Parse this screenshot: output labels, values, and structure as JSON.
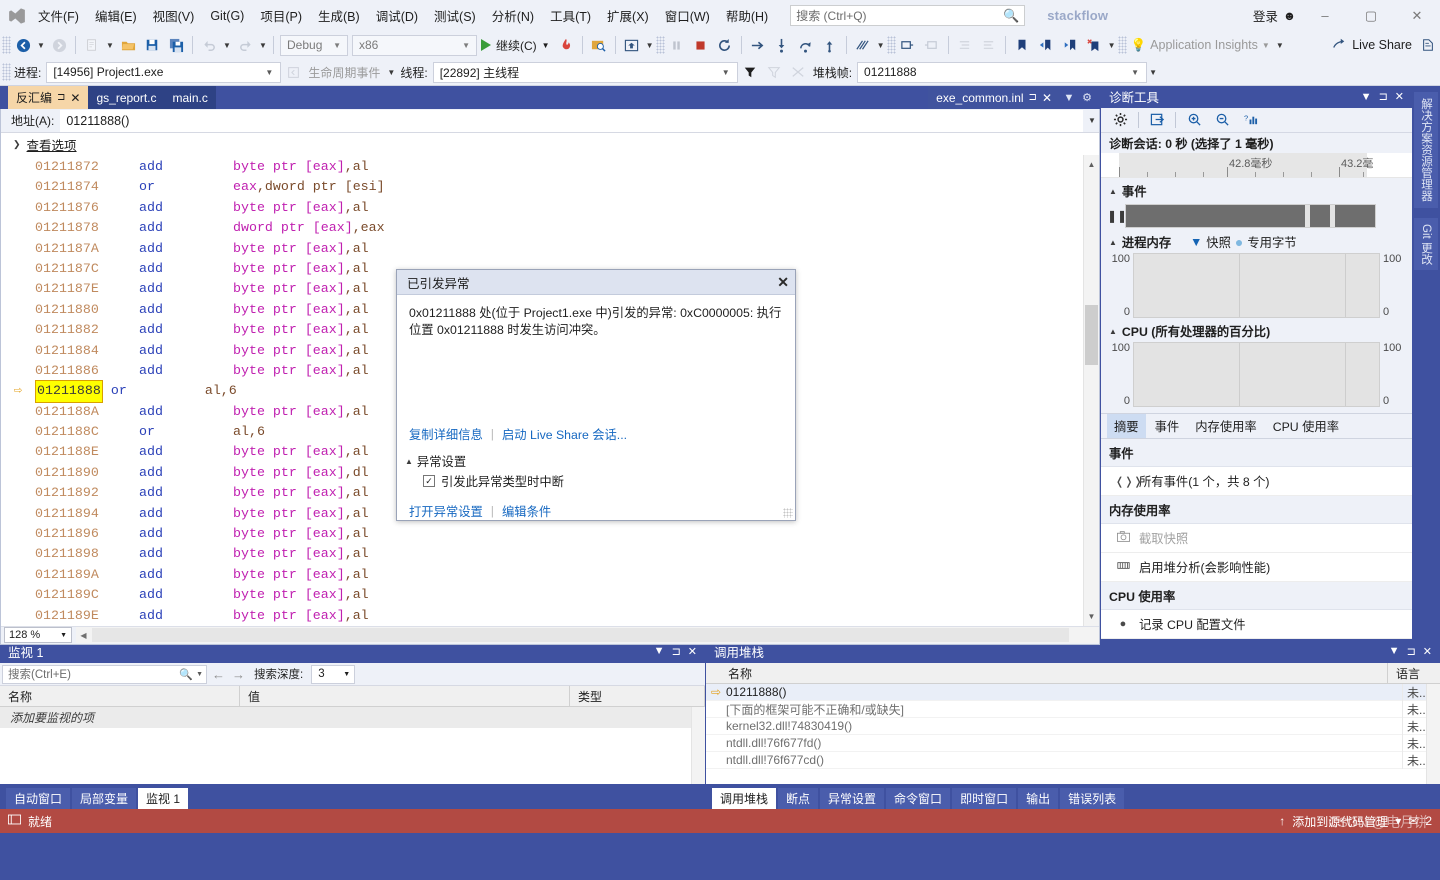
{
  "menu": {
    "logo_icon": "visual-studio-logo",
    "items": [
      "文件(F)",
      "编辑(E)",
      "视图(V)",
      "Git(G)",
      "项目(P)",
      "生成(B)",
      "调试(D)",
      "测试(S)",
      "分析(N)",
      "工具(T)",
      "扩展(X)",
      "窗口(W)",
      "帮助(H)"
    ],
    "search_placeholder": "搜索 (Ctrl+Q)",
    "search_icon": "search-icon",
    "brand": "stackflow",
    "login_label": "登录",
    "login_icon": "account-icon",
    "window_buttons": [
      "–",
      "▢",
      "✕"
    ]
  },
  "toolbar": {
    "nav_back_icon": "navigate-back-icon",
    "nav_forward_icon": "navigate-forward-icon",
    "new_item_icon": "new-item-icon",
    "open_icon": "open-folder-icon",
    "save_icon": "save-icon",
    "save_all_icon": "save-all-icon",
    "undo_icon": "undo-icon",
    "redo_icon": "redo-icon",
    "config_value": "Debug",
    "platform_value": "x86",
    "continue_label": "继续(C)",
    "continue_icon": "play-icon",
    "hot_reload_icon": "hot-reload-icon",
    "attach_icon": "attach-to-process-icon",
    "screenshot_icon": "snapshot-icon",
    "pause_icon": "pause-icon",
    "stop_icon": "stop-icon",
    "restart_icon": "restart-icon",
    "step_over_icon": "step-over-icon",
    "step_into_icon": "step-into-icon",
    "step_out_icon": "step-out-icon",
    "show_next_icon": "show-next-statement-icon",
    "diff_icon": "compare-icon",
    "indent_icon": "indent-icon",
    "comment_icon": "comment-icon",
    "uncomment_icon": "uncomment-icon",
    "bookmark_icon": "bookmark-icon",
    "prev_bookmark_icon": "previous-bookmark-icon",
    "next_bookmark_icon": "next-bookmark-icon",
    "clear_bookmark_icon": "clear-bookmark-icon",
    "app_insights_label": "Application Insights",
    "app_insights_icon": "lightbulb-icon",
    "live_share_label": "Live Share",
    "live_share_icon": "live-share-icon",
    "feedback_icon": "feedback-icon"
  },
  "debugbar": {
    "process_label": "进程:",
    "process_value": "[14956] Project1.exe",
    "lifecycle_label": "生命周期事件",
    "lifecycle_icon": "lifecycle-icon",
    "thread_label": "线程:",
    "thread_value": "[22892] 主线程",
    "filter_icon": "filter-icon",
    "filter2_icon": "filter-clear-icon",
    "flag_icon": "flag-icon",
    "stackframe_label": "堆栈帧:",
    "stackframe_value": "01211888"
  },
  "tabs": {
    "items": [
      {
        "label": "反汇编",
        "active": true,
        "pin": "⊐",
        "close": "✕"
      },
      {
        "label": "gs_report.c",
        "active": false
      },
      {
        "label": "main.c",
        "active": false
      }
    ],
    "right_tab": {
      "label": "exe_common.inl",
      "pin_icon": "pin-icon",
      "close_icon": "close-icon"
    },
    "dropdown_icon": "chevron-down-icon",
    "settings_icon": "gear-icon"
  },
  "disassembly": {
    "address_label": "地址(A):",
    "address_value": "01211888()",
    "view_options_label": "查看选项",
    "zoom_value": "128 %",
    "current_address": "01211888",
    "lines": [
      {
        "addr": "01211872",
        "mn": "add",
        "op": "byte ptr [eax],al"
      },
      {
        "addr": "01211874",
        "mn": "or",
        "op": "eax,dword ptr [esi]"
      },
      {
        "addr": "01211876",
        "mn": "add",
        "op": "byte ptr [eax],al"
      },
      {
        "addr": "01211878",
        "mn": "add",
        "op": "dword ptr [eax],eax"
      },
      {
        "addr": "0121187A",
        "mn": "add",
        "op": "byte ptr [eax],al"
      },
      {
        "addr": "0121187C",
        "mn": "add",
        "op": "byte ptr [eax],al"
      },
      {
        "addr": "0121187E",
        "mn": "add",
        "op": "byte ptr [eax],al"
      },
      {
        "addr": "01211880",
        "mn": "add",
        "op": "byte ptr [eax],al"
      },
      {
        "addr": "01211882",
        "mn": "add",
        "op": "byte ptr [eax],al"
      },
      {
        "addr": "01211884",
        "mn": "add",
        "op": "byte ptr [eax],al"
      },
      {
        "addr": "01211886",
        "mn": "add",
        "op": "byte ptr [eax],al"
      },
      {
        "addr": "01211888",
        "mn": "or",
        "op": "al,6",
        "current": true
      },
      {
        "addr": "0121188A",
        "mn": "add",
        "op": "byte ptr [eax],al"
      },
      {
        "addr": "0121188C",
        "mn": "or",
        "op": "al,6"
      },
      {
        "addr": "0121188E",
        "mn": "add",
        "op": "byte ptr [eax],al"
      },
      {
        "addr": "01211890",
        "mn": "add",
        "op": "byte ptr [eax],dl"
      },
      {
        "addr": "01211892",
        "mn": "add",
        "op": "byte ptr [eax],al"
      },
      {
        "addr": "01211894",
        "mn": "add",
        "op": "byte ptr [eax],al"
      },
      {
        "addr": "01211896",
        "mn": "add",
        "op": "byte ptr [eax],al"
      },
      {
        "addr": "01211898",
        "mn": "add",
        "op": "byte ptr [eax],al"
      },
      {
        "addr": "0121189A",
        "mn": "add",
        "op": "byte ptr [eax],al"
      },
      {
        "addr": "0121189C",
        "mn": "add",
        "op": "byte ptr [eax],al"
      },
      {
        "addr": "0121189E",
        "mn": "add",
        "op": "byte ptr [eax],al"
      }
    ]
  },
  "exception_dialog": {
    "title": "已引发异常",
    "close_icon": "close-icon",
    "message": "0x01211888 处(位于 Project1.exe 中)引发的异常: 0xC0000005: 执行位置 0x01211888 时发生访问冲突。",
    "copy_details_link": "复制详细信息",
    "live_share_link": "启动 Live Share 会话...",
    "settings_section": "异常设置",
    "break_checkbox_label": "引发此异常类型时中断",
    "checkbox_mark": "✓",
    "open_settings_link": "打开异常设置",
    "edit_conditions_link": "编辑条件"
  },
  "diagnostics": {
    "title": "诊断工具",
    "dropdown_icon": "chevron-down-icon",
    "pin_icon": "pin-icon",
    "close_icon": "close-icon",
    "toolbar_icons": [
      "gear-icon",
      "export-icon",
      "zoom-in-icon",
      "zoom-out-icon",
      "reset-zoom-icon"
    ],
    "session_label": "诊断会话: 0 秒 (选择了 1 毫秒)",
    "ruler_labels": [
      "42.8毫秒",
      "43.2毫"
    ],
    "events_section": "事件",
    "events_icon": "pause-icon",
    "memory_section": "进程内存",
    "memory_legend_snapshot": "快照",
    "memory_legend_private": "专用字节",
    "memory_axis": [
      "100",
      "0"
    ],
    "cpu_section": "CPU (所有处理器的百分比)",
    "cpu_axis": [
      "100",
      "0"
    ],
    "tabs": [
      "摘要",
      "事件",
      "内存使用率",
      "CPU 使用率"
    ],
    "active_tab": "摘要",
    "summary": {
      "events_header": "事件",
      "events_item": "所有事件(1 个，共 8 个)",
      "events_item_icon": "events-icon",
      "memory_header": "内存使用率",
      "memory_item1": "截取快照",
      "memory_item1_icon": "camera-icon",
      "memory_item2": "启用堆分析(会影响性能)",
      "memory_item2_icon": "heap-icon",
      "cpu_header": "CPU 使用率",
      "cpu_item": "记录 CPU 配置文件",
      "cpu_item_icon": "record-icon"
    }
  },
  "vertical_tabs": [
    "解决方案资源管理器",
    "Git 更改"
  ],
  "watch": {
    "title": "监视 1",
    "dropdown_icon": "chevron-down-icon",
    "pin_icon": "pin-icon",
    "close_icon": "close-icon",
    "search_placeholder": "搜索(Ctrl+E)",
    "search_icon": "search-icon",
    "back_icon": "arrow-left-icon",
    "forward_icon": "arrow-right-icon",
    "depth_label": "搜索深度:",
    "depth_value": "3",
    "columns": [
      "名称",
      "值",
      "类型"
    ],
    "empty_text": "添加要监视的项"
  },
  "callstack": {
    "title": "调用堆栈",
    "dropdown_icon": "chevron-down-icon",
    "pin_icon": "pin-icon",
    "close_icon": "close-icon",
    "columns": [
      "名称",
      "语言"
    ],
    "rows": [
      {
        "name": "01211888()",
        "lang": "未...",
        "current": true
      },
      {
        "name": "[下面的框架可能不正确和/或缺失]",
        "lang": "未...",
        "gray": true
      },
      {
        "name": "kernel32.dll!74830419()",
        "lang": "未...",
        "gray": true
      },
      {
        "name": "ntdll.dll!76f677fd()",
        "lang": "未...",
        "gray": true
      },
      {
        "name": "ntdll.dll!76f677cd()",
        "lang": "未...",
        "gray": true
      }
    ]
  },
  "bottom_tabs_left": {
    "items": [
      "自动窗口",
      "局部变量",
      "监视 1"
    ],
    "active": "监视 1"
  },
  "bottom_tabs_right": {
    "items": [
      "调用堆栈",
      "断点",
      "异常设置",
      "命令窗口",
      "即时窗口",
      "输出",
      "错误列表"
    ],
    "active": "调用堆栈"
  },
  "status": {
    "icon": "ready-icon",
    "text": "就绪",
    "source_control_label": "添加到源代码管理",
    "source_control_icon": "arrow-up-icon",
    "select_icon": "select-repo-icon",
    "notify_icon": "notification-icon",
    "notify_count": "2",
    "watermark": "CSDN @电月饼"
  },
  "colors": {
    "brand_blue": "#3f51a0",
    "status_red": "#b24a43",
    "active_tab": "#f6d6a8",
    "highlight_yellow": "#ffff00",
    "link_blue": "#1668c1",
    "mnemonic_blue": "#2b41b8",
    "operand_magenta": "#c020b0",
    "address_tan": "#c08a5e"
  }
}
